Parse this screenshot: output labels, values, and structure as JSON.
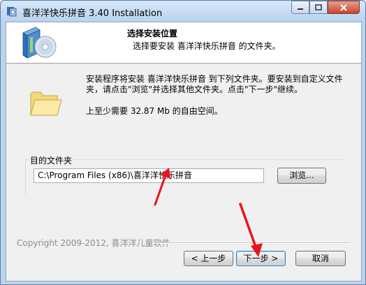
{
  "window": {
    "title": "喜洋洋快乐拼音 3.40 Installation",
    "icon": "installer-app-icon"
  },
  "header": {
    "title": "选择安装位置",
    "subtitle": "选择要安装 喜洋洋快乐拼音 的文件夹。"
  },
  "body": {
    "description": "安装程序将安装 喜洋洋快乐拼音 到下列文件夹。要安装到自定义文件夹，请点击\"浏览\"并选择其他文件夹。点击\"下一步\"继续。",
    "space_required": "上至少需要 32.87 Mb 的自由空间。",
    "destination_group_label": "目的文件夹",
    "destination_path": "C:\\Program Files (x86)\\喜洋洋快乐拼音",
    "browse_label": "浏览..."
  },
  "footer": {
    "copyright": "Copyright 2009-2012, 喜洋洋儿童软件",
    "back_label": "< 上一步",
    "next_label": "下一步 >",
    "cancel_label": "取消"
  },
  "colors": {
    "annotation_arrow": "#e8141e",
    "titlebar": "#bcd3ee",
    "close_button": "#c7432b"
  }
}
